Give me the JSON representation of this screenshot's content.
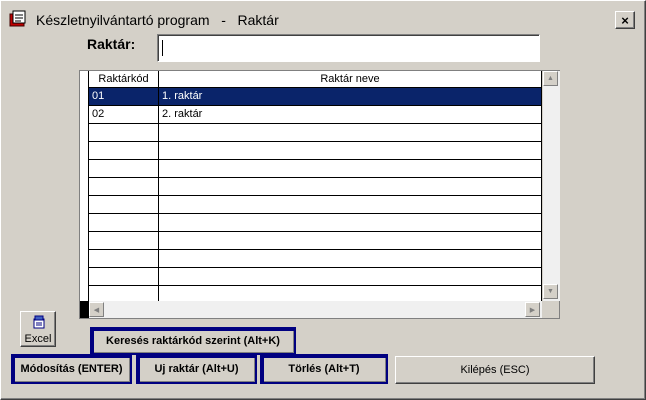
{
  "window": {
    "title": "Készletnyilvántartó program   -   Raktár",
    "close_label": "×"
  },
  "search": {
    "label": "Raktár:",
    "value": ""
  },
  "table": {
    "columns": [
      "Raktárkód",
      "Raktár neve"
    ],
    "rows": [
      {
        "code": "01",
        "name": "1. raktár",
        "selected": true
      },
      {
        "code": "02",
        "name": "2. raktár",
        "selected": false
      }
    ],
    "empty_rows": 10
  },
  "buttons": {
    "excel": "Excel",
    "search_by_code": "Keresés raktárkód szerint (Alt+K)",
    "modify": "Módosítás (ENTER)",
    "new": "Uj raktár (Alt+U)",
    "delete": "Törlés (Alt+T)",
    "exit": "Kilépés (ESC)"
  },
  "colors": {
    "selection": "#0a246a",
    "window_bg": "#d4d0c8"
  }
}
